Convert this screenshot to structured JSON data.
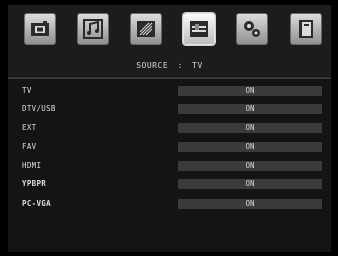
{
  "header": {
    "source_label": "SOURCE",
    "separator": ":",
    "source_value": "TV"
  },
  "menu_icons": [
    {
      "name": "picture-icon",
      "selected": false
    },
    {
      "name": "sound-icon",
      "selected": false
    },
    {
      "name": "settings-brush-icon",
      "selected": false
    },
    {
      "name": "input-source-icon",
      "selected": true
    },
    {
      "name": "gear-icon",
      "selected": false
    },
    {
      "name": "info-book-icon",
      "selected": false
    }
  ],
  "sources": [
    {
      "label": "TV",
      "value": "ON"
    },
    {
      "label": "DTV/USB",
      "value": "ON"
    },
    {
      "label": "EXT",
      "value": "ON"
    },
    {
      "label": "FAV",
      "value": "ON"
    },
    {
      "label": "HDMI",
      "value": "ON"
    },
    {
      "label": "YPBPR",
      "value": "ON"
    },
    {
      "label": "PC-VGA",
      "value": "ON"
    }
  ]
}
